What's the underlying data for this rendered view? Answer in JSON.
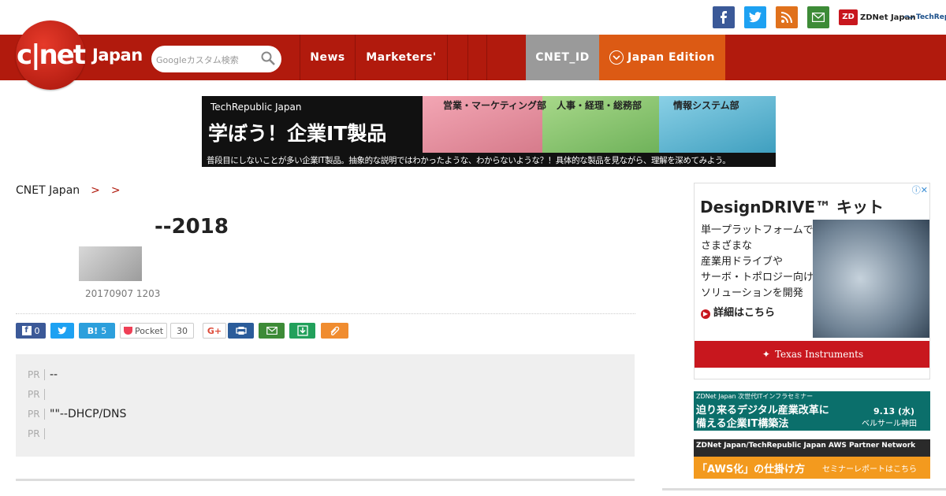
{
  "header": {
    "logo_text": "c|net",
    "logo_region": "Japan",
    "search_placeholder": "Googleカスタム検索",
    "social": [
      "facebook-icon",
      "twitter-icon",
      "rss-icon",
      "mail-icon"
    ],
    "partner_links": [
      "ZDNet Japan",
      "TechRepublic"
    ]
  },
  "nav": {
    "items": [
      "News",
      "Marketers'",
      "",
      "",
      "",
      "CNET_ID",
      "Japan Edition"
    ]
  },
  "banner": {
    "brand": "TechRepublic Japan",
    "headline": "学ぼう！企業IT製品",
    "tag1": "営業・マーケティング部",
    "tag2": "人事・経理・総務部",
    "tag3": "情報システム部",
    "footer": "普段目にしないことが多い企業IT製品。抽象的な説明ではわかったような、わからないような？！具体的な製品を見ながら、理解を深めてみよう。"
  },
  "breadcrumb": [
    "CNET Japan",
    "",
    ""
  ],
  "article": {
    "title": "--2018",
    "author": "",
    "date": "20170907 1203"
  },
  "share": {
    "facebook_count": "0",
    "hatena_count": "5",
    "pocket_label": "Pocket",
    "pocket_count": "30",
    "gplus_label": "G+"
  },
  "pr": {
    "tag": "PR",
    "items": [
      "--",
      "",
      "\"\"--DHCP/DNS",
      ""
    ]
  },
  "side_ad": {
    "brand": "DesignDRIVE™ キット",
    "lines": [
      "単一プラットフォームで",
      "さまざまな",
      "産業用ドライブや",
      "サーボ・トポロジー向け",
      "ソリューションを開発"
    ],
    "cta": "詳細はこちら",
    "sponsor": "Texas Instruments"
  },
  "side_banner1": {
    "top": "ZDNet Japan 次世代ITインフラセミナー",
    "line1": "迫り来るデジタル産業改革に",
    "line2": "備える企業IT構築法",
    "date": "9.13 (水)",
    "venue": "ベルサール神田"
  },
  "side_banner2": {
    "top": "ZDNet Japan/TechRepublic Japan AWS Partner Network",
    "main": "「AWS化」の仕掛け方",
    "sub": "セミナーレポートはこちら"
  },
  "colors": {
    "brand_red": "#b11a0d",
    "cnet_id_gray": "#9a9a9a",
    "edition_orange": "#dc5a14"
  }
}
